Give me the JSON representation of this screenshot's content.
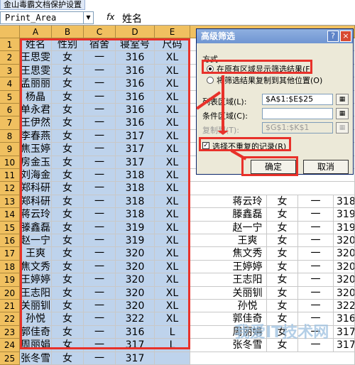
{
  "app_title": "金山毒霸文档保护设置",
  "formula_bar": {
    "name_box": "Print_Area",
    "fx": "fx",
    "formula": "姓名"
  },
  "columns": [
    "A",
    "B",
    "C",
    "D",
    "E"
  ],
  "left_rows": [
    {
      "n": "1",
      "a": "姓名",
      "b": "性别",
      "c": "宿舍",
      "d": "寝室号",
      "e": "尺码"
    },
    {
      "n": "2",
      "a": "王思雯",
      "b": "女",
      "c": "一",
      "d": "316",
      "e": "XL"
    },
    {
      "n": "3",
      "a": "王思雯",
      "b": "女",
      "c": "一",
      "d": "316",
      "e": "XL"
    },
    {
      "n": "4",
      "a": "孟丽丽",
      "b": "女",
      "c": "一",
      "d": "316",
      "e": "XL"
    },
    {
      "n": "5",
      "a": "杨晶",
      "b": "女",
      "c": "一",
      "d": "316",
      "e": "XL"
    },
    {
      "n": "6",
      "a": "单永君",
      "b": "女",
      "c": "一",
      "d": "316",
      "e": "XL"
    },
    {
      "n": "7",
      "a": "王伊然",
      "b": "女",
      "c": "一",
      "d": "316",
      "e": "XL"
    },
    {
      "n": "8",
      "a": "李春燕",
      "b": "女",
      "c": "一",
      "d": "317",
      "e": "XL"
    },
    {
      "n": "9",
      "a": "焦玉婷",
      "b": "女",
      "c": "一",
      "d": "317",
      "e": "XL"
    },
    {
      "n": "10",
      "a": "房金玉",
      "b": "女",
      "c": "一",
      "d": "317",
      "e": "XL"
    },
    {
      "n": "11",
      "a": "刘海金",
      "b": "女",
      "c": "一",
      "d": "318",
      "e": "XL"
    },
    {
      "n": "12",
      "a": "郑科研",
      "b": "女",
      "c": "一",
      "d": "318",
      "e": "XL"
    },
    {
      "n": "13",
      "a": "郑科研",
      "b": "女",
      "c": "一",
      "d": "318",
      "e": "XL"
    },
    {
      "n": "14",
      "a": "蒋云玲",
      "b": "女",
      "c": "一",
      "d": "318",
      "e": "XL"
    },
    {
      "n": "15",
      "a": "滕鑫磊",
      "b": "女",
      "c": "一",
      "d": "319",
      "e": "XL"
    },
    {
      "n": "16",
      "a": "赵一宁",
      "b": "女",
      "c": "一",
      "d": "319",
      "e": "XL"
    },
    {
      "n": "17",
      "a": "王爽",
      "b": "女",
      "c": "一",
      "d": "320",
      "e": "XL"
    },
    {
      "n": "18",
      "a": "焦文秀",
      "b": "女",
      "c": "一",
      "d": "320",
      "e": "XL"
    },
    {
      "n": "19",
      "a": "王婷婷",
      "b": "女",
      "c": "一",
      "d": "320",
      "e": "XL"
    },
    {
      "n": "20",
      "a": "王志阳",
      "b": "女",
      "c": "一",
      "d": "320",
      "e": "XL"
    },
    {
      "n": "21",
      "a": "关丽钏",
      "b": "女",
      "c": "一",
      "d": "320",
      "e": "XL"
    },
    {
      "n": "22",
      "a": "孙悦",
      "b": "女",
      "c": "一",
      "d": "322",
      "e": "XL"
    },
    {
      "n": "23",
      "a": "郭佳奇",
      "b": "女",
      "c": "一",
      "d": "316",
      "e": "L"
    },
    {
      "n": "24",
      "a": "周丽娟",
      "b": "女",
      "c": "一",
      "d": "317",
      "e": "L"
    },
    {
      "n": "25",
      "a": "张冬雪",
      "b": "女",
      "c": "一",
      "d": "317",
      "e": ""
    }
  ],
  "right_rows": [
    {
      "a": "蒋云玲",
      "b": "女",
      "c": "一",
      "d": "318"
    },
    {
      "a": "滕鑫磊",
      "b": "女",
      "c": "一",
      "d": "319"
    },
    {
      "a": "赵一宁",
      "b": "女",
      "c": "一",
      "d": "319"
    },
    {
      "a": "王爽",
      "b": "女",
      "c": "一",
      "d": "320"
    },
    {
      "a": "焦文秀",
      "b": "女",
      "c": "一",
      "d": "320"
    },
    {
      "a": "王婷婷",
      "b": "女",
      "c": "一",
      "d": "320"
    },
    {
      "a": "王志阳",
      "b": "女",
      "c": "一",
      "d": "320"
    },
    {
      "a": "关丽钏",
      "b": "女",
      "c": "一",
      "d": "320"
    },
    {
      "a": "孙悦",
      "b": "女",
      "c": "一",
      "d": "322"
    },
    {
      "a": "郭佳奇",
      "b": "女",
      "c": "一",
      "d": "316"
    },
    {
      "a": "周丽娟",
      "b": "女",
      "c": "一",
      "d": "317"
    },
    {
      "a": "张冬雪",
      "b": "女",
      "c": "一",
      "d": "317"
    }
  ],
  "dialog": {
    "title": "高级筛选",
    "help": "?",
    "close": "×",
    "method_label": "方式",
    "option1": "在原有区域显示筛选结果(F)",
    "option2": "将筛选结果复制到其他位置(O)",
    "list_range_label": "列表区域(L):",
    "list_range_value": "$A$1:$E$25",
    "criteria_label": "条件区域(C):",
    "criteria_value": "",
    "copy_to_label": "复制到(T):",
    "copy_to_value": "$G$1:$K$1",
    "unique_label": "选择不重复的记录(R)",
    "ok": "确定",
    "cancel": "取消"
  },
  "watermark": "我爱IT技术网"
}
